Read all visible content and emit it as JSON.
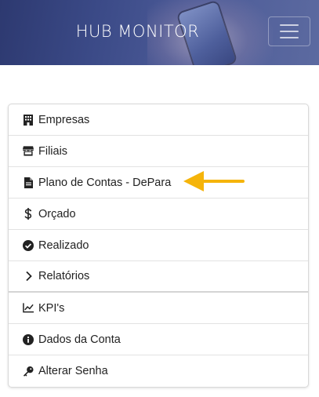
{
  "header": {
    "title": "HUB MONITOR"
  },
  "menu": {
    "items": [
      {
        "label": "Empresas",
        "icon": "building-icon"
      },
      {
        "label": "Filiais",
        "icon": "store-icon"
      },
      {
        "label": "Plano de Contas - DePara",
        "icon": "file-icon"
      },
      {
        "label": "Orçado",
        "icon": "dollar-icon"
      },
      {
        "label": "Realizado",
        "icon": "check-circle-icon"
      },
      {
        "label": "Relatórios",
        "icon": "chevron-right-icon"
      },
      {
        "label": "KPI's",
        "icon": "chart-line-icon"
      },
      {
        "label": "Dados da Conta",
        "icon": "info-circle-icon"
      },
      {
        "label": "Alterar Senha",
        "icon": "key-icon"
      }
    ]
  },
  "annotation": {
    "arrow_color": "#f5b40a",
    "points_to": "Plano de Contas - DePara"
  },
  "colors": {
    "header": "#3b4a87",
    "text": "#222222",
    "border": "#d9d9d9"
  }
}
